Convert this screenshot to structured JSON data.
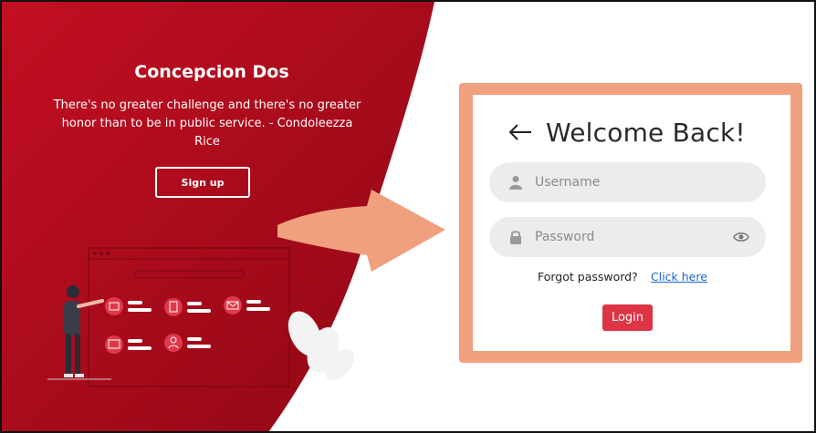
{
  "hero": {
    "title": "Concepcion Dos",
    "quote": "There's no greater challenge and there's no greater honor than to be in public service. - Condoleezza Rice",
    "signup_label": "Sign up"
  },
  "login": {
    "heading": "Welcome Back!",
    "username_placeholder": "Username",
    "password_placeholder": "Password",
    "forgot_text": "Forgot password?",
    "forgot_link": "Click here",
    "login_label": "Login"
  },
  "colors": {
    "hero_red": "#a3091a",
    "card_border": "#f0a07e",
    "arrow": "#f0a07e",
    "login_button": "#dc3545",
    "link": "#1a63d6"
  },
  "icons": [
    "back-arrow-icon",
    "user-icon",
    "lock-icon",
    "eye-icon",
    "folder-icon",
    "document-icon",
    "mail-icon",
    "image-icon",
    "profile-icon"
  ]
}
